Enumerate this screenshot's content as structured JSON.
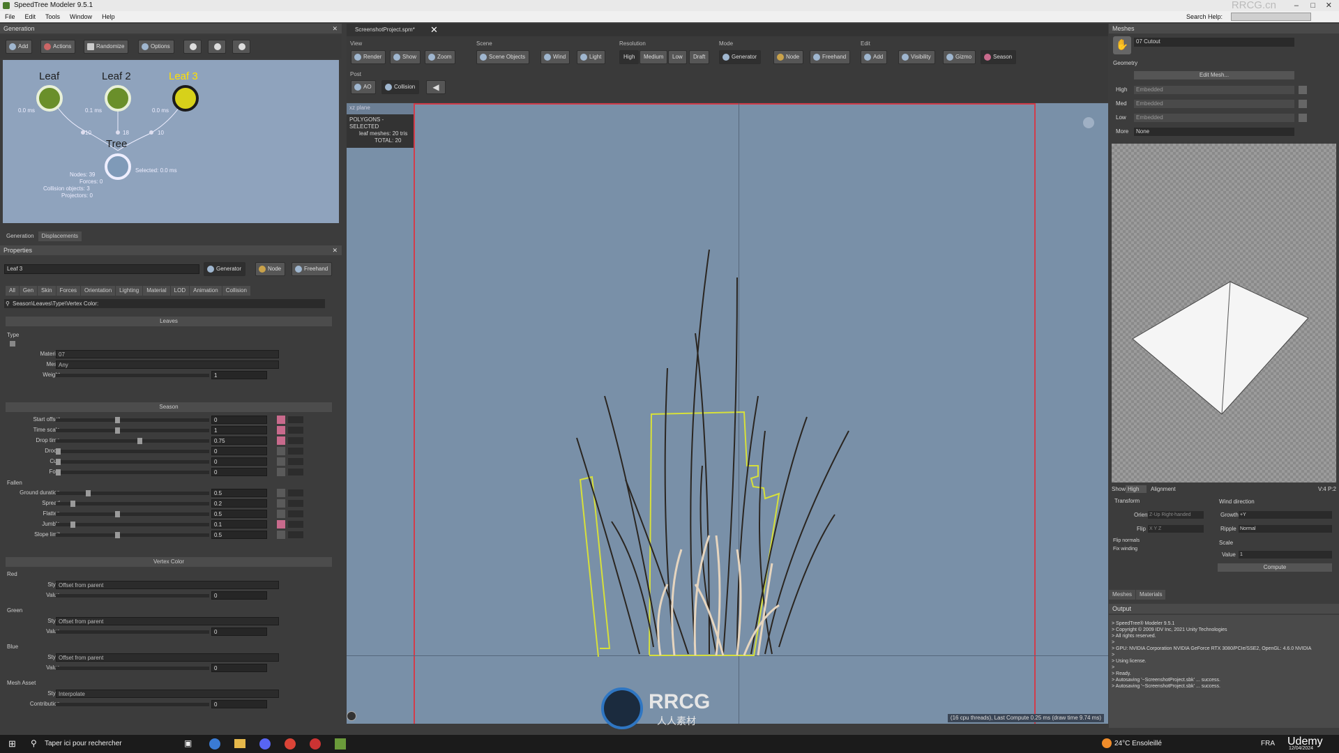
{
  "window": {
    "title": "SpeedTree Modeler 9.5.1",
    "watermark": "RRCG.cn"
  },
  "menu": {
    "items": [
      "File",
      "Edit",
      "Tools",
      "Window",
      "Help"
    ],
    "search_label": "Search Help:"
  },
  "generation": {
    "panel_title": "Generation",
    "toolbar": [
      "Add",
      "Actions",
      "Randomize",
      "Options"
    ],
    "nodes": [
      {
        "name": "Leaf",
        "ms": "0.0 ms"
      },
      {
        "name": "Leaf 2",
        "ms": "0.1 ms"
      },
      {
        "name": "Leaf 3",
        "ms": "0.0 ms"
      },
      {
        "name": "Tree",
        "ms": ""
      }
    ],
    "counts": [
      "10",
      "18",
      "10"
    ],
    "selected": "Selected: 0.0 ms",
    "stats": {
      "nodes": "Nodes: 39",
      "forces": "Forces: 0",
      "collision": "Collision objects: 3",
      "projectors": "Projectors: 0"
    },
    "tabs": [
      "Generation",
      "Displacements"
    ]
  },
  "properties": {
    "panel_title": "Properties",
    "object_name": "Leaf 3",
    "modes": [
      "Generator",
      "Node",
      "Freehand"
    ],
    "tabs": [
      "All",
      "Gen",
      "Skin",
      "Forces",
      "Orientation",
      "Lighting",
      "Material",
      "LOD",
      "Animation",
      "Collision"
    ],
    "breadcrumb": "Season\\Leaves\\Type\\Vertex Color:",
    "leaves": {
      "title": "Leaves",
      "type_label": "Type",
      "material_label": "Material",
      "material_value": "07",
      "mesh_label": "Mesh",
      "mesh_value": "Any",
      "weight_label": "Weight",
      "weight_value": "1"
    },
    "season": {
      "title": "Season",
      "rows": [
        {
          "label": "Start offset",
          "value": "0",
          "pos": 0.4,
          "pink": true
        },
        {
          "label": "Time scale",
          "value": "1",
          "pos": 0.4,
          "pink": true
        },
        {
          "label": "Drop time",
          "value": "0.75",
          "pos": 0.55,
          "pink": true
        },
        {
          "label": "Droop",
          "value": "0",
          "pos": 0.0,
          "pink": false
        },
        {
          "label": "Curl",
          "value": "0",
          "pos": 0.0,
          "pink": false
        },
        {
          "label": "Fold",
          "value": "0",
          "pos": 0.0,
          "pink": false
        }
      ],
      "fallen_label": "Fallen",
      "fallen_rows": [
        {
          "label": "Ground duration",
          "value": "0.5",
          "pos": 0.2,
          "pink": false
        },
        {
          "label": "Spread",
          "value": "0.2",
          "pos": 0.1,
          "pink": false
        },
        {
          "label": "Flatten",
          "value": "0.5",
          "pos": 0.4,
          "pink": false
        },
        {
          "label": "Jumble",
          "value": "0.1",
          "pos": 0.1,
          "pink": true
        },
        {
          "label": "Slope limit",
          "value": "0.5",
          "pos": 0.4,
          "pink": false
        }
      ]
    },
    "vertex_color": {
      "title": "Vertex Color",
      "groups": [
        {
          "name": "Red",
          "style": "Offset from parent",
          "value": "0"
        },
        {
          "name": "Green",
          "style": "Offset from parent",
          "value": "0"
        },
        {
          "name": "Blue",
          "style": "Offset from parent",
          "value": "0"
        }
      ],
      "style_label": "Style",
      "value_label": "Value"
    },
    "mesh_asset": {
      "title": "Mesh Asset",
      "style_label": "Style",
      "style": "Interpolate",
      "contribution_label": "Contribution",
      "contribution": "0"
    }
  },
  "editor": {
    "tab": "ScreenshotProject.spm*",
    "groups": {
      "view": "View",
      "scene": "Scene",
      "resolution": "Resolution",
      "mode": "Mode",
      "edit": "Edit",
      "post": "Post"
    },
    "view_buttons": [
      "Render",
      "Show",
      "Zoom"
    ],
    "scene_buttons": [
      "Scene Objects",
      "Wind",
      "Light"
    ],
    "resolution_buttons": [
      "High",
      "Medium",
      "Low",
      "Draft"
    ],
    "mode_buttons": [
      "Generator",
      "Node",
      "Freehand"
    ],
    "edit_buttons": [
      "Add",
      "Visibility",
      "Gizmo",
      "Season"
    ],
    "post_buttons": [
      "AO",
      "Collision"
    ],
    "overlay": {
      "label": "xz plane",
      "title": "POLYGONS - SELECTED",
      "leaf_meshes": "leaf meshes: 20 tris",
      "total": "TOTAL: 20"
    },
    "status": "(16 cpu threads), Last Compute 0.25 ms (draw time 9.74 ms)"
  },
  "meshes": {
    "panel_title": "Meshes",
    "mesh_name": "07 Cutout",
    "geometry_label": "Geometry",
    "edit_mesh": "Edit Mesh...",
    "lods": [
      {
        "label": "High",
        "value": "Embedded"
      },
      {
        "label": "Med",
        "value": "Embedded"
      },
      {
        "label": "Low",
        "value": "Embedded"
      }
    ],
    "more_label": "More",
    "more_value": "None",
    "show_label": "Show",
    "show_value": "High",
    "alignment": "Alignment",
    "vert_info": "V:4 P:2",
    "transform_label": "Transform",
    "orient_label": "Orient",
    "orient_value": "Z-Up Right-handed",
    "flip_label": "Flip",
    "flip_value": "X Y Z",
    "flip_normals": "Flip normals",
    "fix_winding": "Fix winding",
    "wind_label": "Wind direction",
    "growth_label": "Growth",
    "growth_value": "+Y",
    "ripple_label": "Ripple",
    "ripple_value": "Normal",
    "scale_label": "Scale",
    "value_label": "Value",
    "scale_value": "1",
    "compute": "Compute",
    "tabs": [
      "Meshes",
      "Materials"
    ]
  },
  "output": {
    "panel_title": "Output",
    "lines": [
      "> SpeedTree® Modeler 9.5.1",
      "> Copyright © 2009 IDV Inc, 2021 Unity Technologies",
      "> All rights reserved.",
      ">",
      "> GPU: NVIDIA Corporation NVIDIA GeForce RTX 3080/PCIe/SSE2, OpenGL: 4.6.0 NVIDIA",
      ">",
      "> Using license.",
      ">",
      "> Ready.",
      "> Autosaving '~ScreenshotProject.sbk' ... success.",
      "> Autosaving '~ScreenshotProject.sbk' ... success."
    ]
  },
  "taskbar": {
    "search": "Taper ici pour rechercher",
    "weather": "24°C Ensoleillé",
    "lang": "FRA",
    "date": "12/04/2024",
    "brand": "Udemy"
  },
  "logo": {
    "text": "RRCG",
    "sub": "人人素材"
  },
  "colors": {
    "accent_yellow": "#ffe000",
    "viewport": "#7990a8",
    "graph": "#8fa3bd",
    "selection_outline": "#d7e03a"
  }
}
